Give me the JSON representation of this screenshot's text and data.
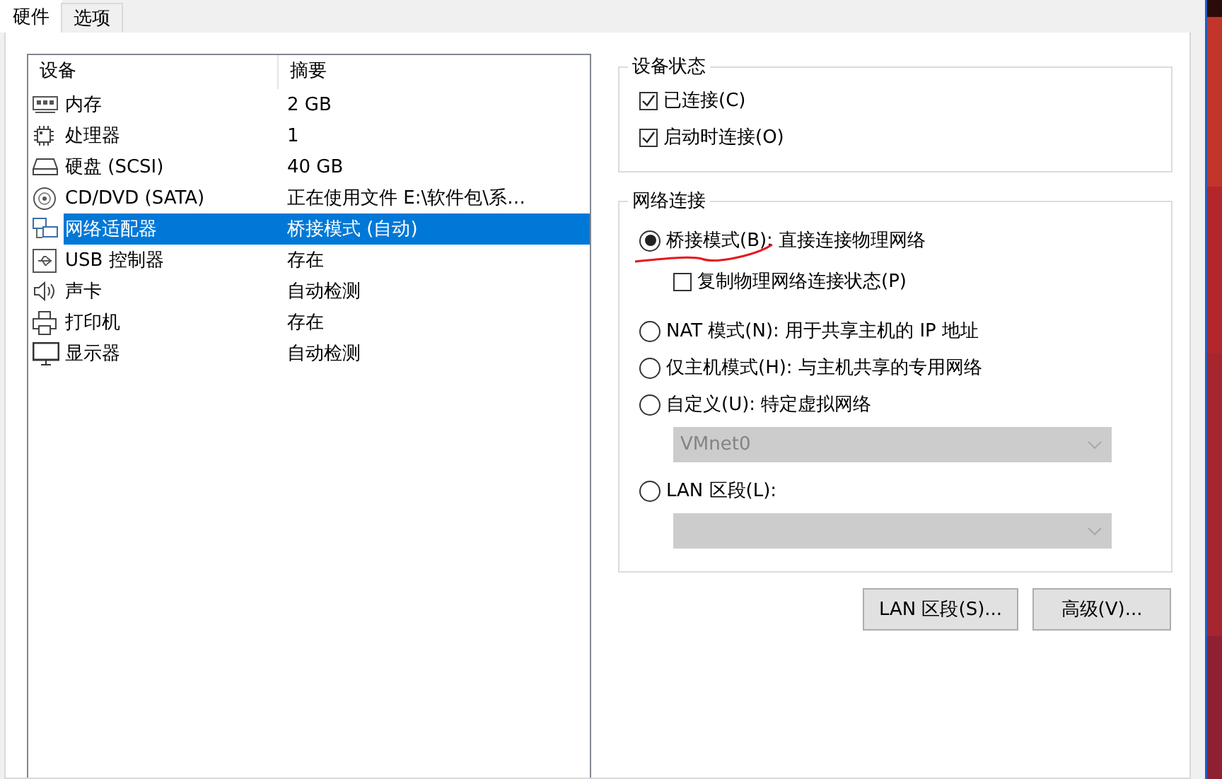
{
  "tabs": [
    {
      "label": "硬件",
      "selected": true
    },
    {
      "label": "选项",
      "selected": false
    }
  ],
  "device_list": {
    "columns": [
      "设备",
      "摘要"
    ],
    "rows": [
      {
        "kind": "memory",
        "device": "内存",
        "summary": "2 GB",
        "selected": false
      },
      {
        "kind": "cpu",
        "device": "处理器",
        "summary": "1",
        "selected": false
      },
      {
        "kind": "disk",
        "device": "硬盘 (SCSI)",
        "summary": "40 GB",
        "selected": false
      },
      {
        "kind": "disc",
        "device": "CD/DVD (SATA)",
        "summary": "正在使用文件 E:\\软件包\\系…",
        "selected": false
      },
      {
        "kind": "network",
        "device": "网络适配器",
        "summary": "桥接模式 (自动)",
        "selected": true
      },
      {
        "kind": "usb",
        "device": "USB 控制器",
        "summary": "存在",
        "selected": false
      },
      {
        "kind": "sound",
        "device": "声卡",
        "summary": "自动检测",
        "selected": false
      },
      {
        "kind": "printer",
        "device": "打印机",
        "summary": "存在",
        "selected": false
      },
      {
        "kind": "display",
        "device": "显示器",
        "summary": "自动检测",
        "selected": false
      }
    ]
  },
  "device_status": {
    "title": "设备状态",
    "options": [
      {
        "label": "已连接(C)",
        "checked": true
      },
      {
        "label": "启动时连接(O)",
        "checked": true
      }
    ]
  },
  "network_connection": {
    "title": "网络连接",
    "options": [
      {
        "kind": "radio",
        "label": "桥接模式(B): 直接连接物理网络",
        "selected": true
      },
      {
        "kind": "checkbox",
        "label": "复制物理网络连接状态(P)",
        "checked": false
      },
      {
        "kind": "radio",
        "label": "NAT 模式(N): 用于共享主机的 IP 地址",
        "selected": false
      },
      {
        "kind": "radio",
        "label": "仅主机模式(H): 与主机共享的专用网络",
        "selected": false
      },
      {
        "kind": "radio",
        "label": "自定义(U): 特定虚拟网络",
        "selected": false
      },
      {
        "kind": "dropdown",
        "value": "VMnet0",
        "disabled": true
      },
      {
        "kind": "radio",
        "label": "LAN 区段(L):",
        "selected": false
      },
      {
        "kind": "dropdown",
        "disabled": true
      }
    ]
  },
  "buttons": [
    "LAN 区段(S)...",
    "高级(V)..."
  ]
}
